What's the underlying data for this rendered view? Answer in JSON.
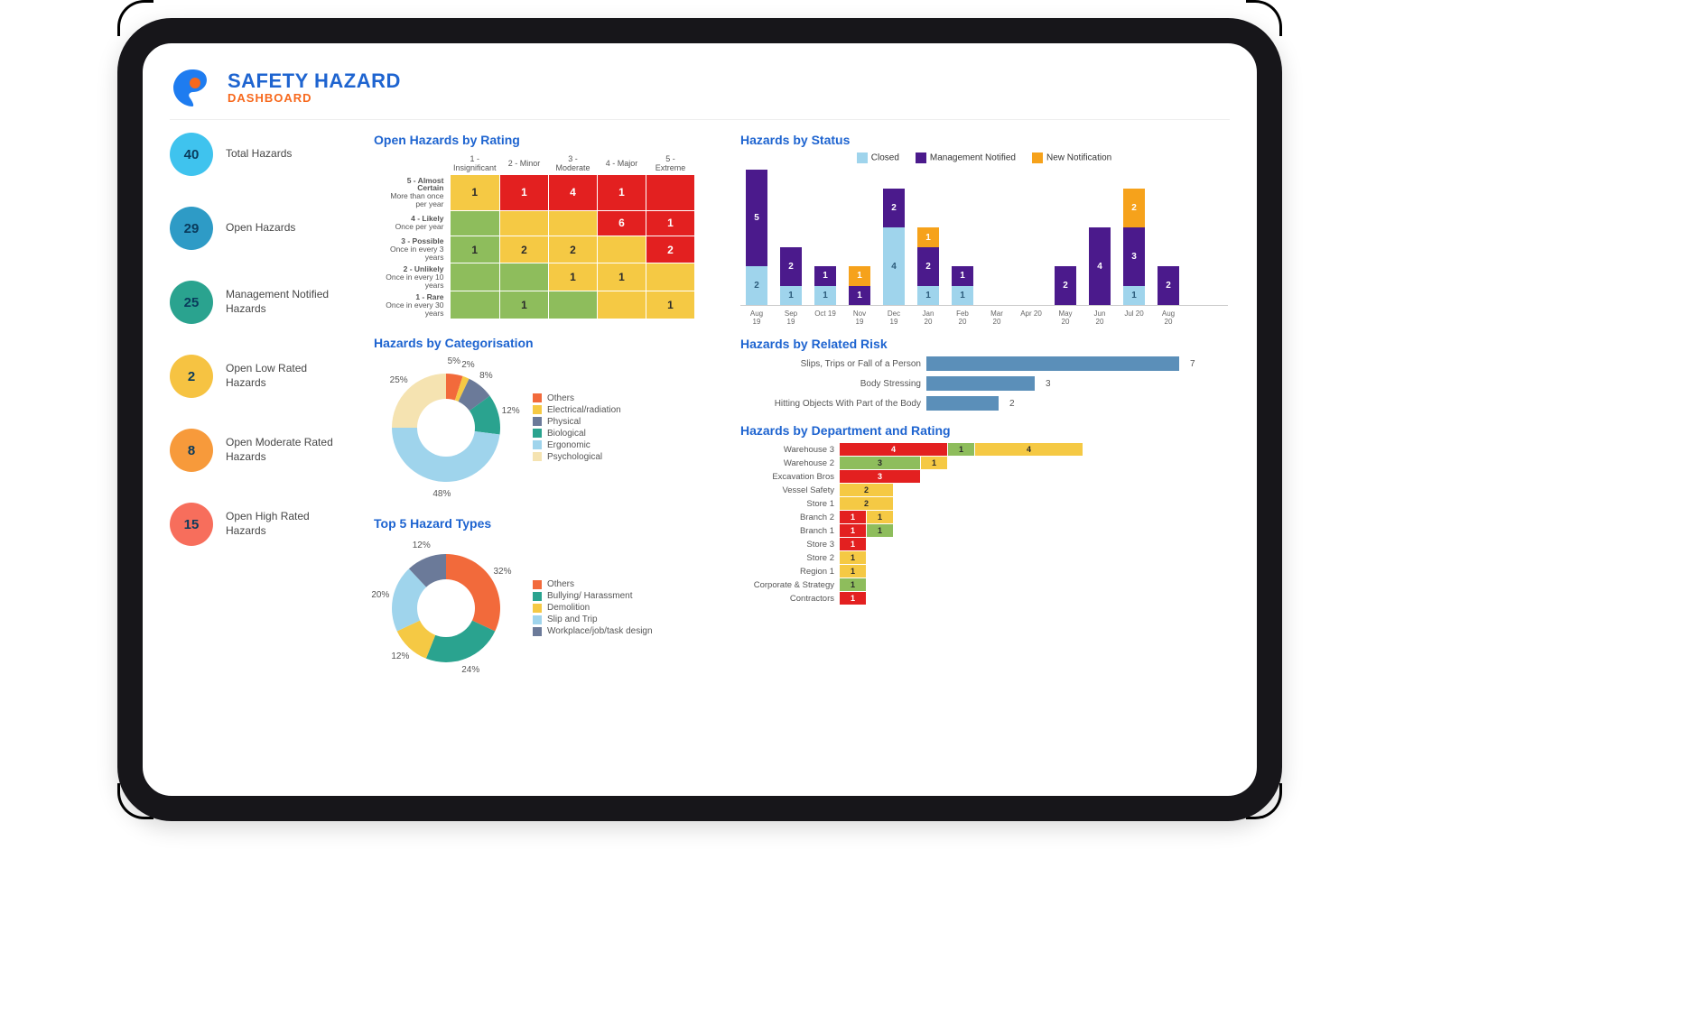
{
  "header": {
    "title": "SAFETY HAZARD",
    "subtitle": "DASHBOARD"
  },
  "colors": {
    "blue": "#1e64d0",
    "orange": "#f7681c",
    "kpi": {
      "total": "#3fc3ee",
      "open": "#2e9bc6",
      "mgmt": "#2aa38f",
      "low": "#f6c342",
      "moderate": "#f79a3b",
      "high": "#f76e5c"
    },
    "matrix": {
      "green": "#8ebd5c",
      "yellow": "#f5c944",
      "red": "#e32020"
    },
    "status": {
      "closed": "#9fd4ec",
      "mgmt": "#4b1a8c",
      "new": "#f6a21b"
    },
    "donutA": [
      "#f26a3b",
      "#f5c944",
      "#6b7a99",
      "#2aa38f",
      "#9fd4ec",
      "#f5e3b1"
    ],
    "donutB": [
      "#f26a3b",
      "#2aa38f",
      "#f5c944",
      "#9fd4ec",
      "#6b7a99"
    ],
    "dept": {
      "red": "#e32020",
      "green": "#8ebd5c",
      "yellow": "#f5c944"
    }
  },
  "kpis": [
    {
      "value": "40",
      "label": "Total Hazards",
      "colorKey": "total"
    },
    {
      "value": "29",
      "label": "Open Hazards",
      "colorKey": "open"
    },
    {
      "value": "25",
      "label": "Management Notified Hazards",
      "colorKey": "mgmt"
    },
    {
      "value": "2",
      "label": "Open Low Rated Hazards",
      "colorKey": "low"
    },
    {
      "value": "8",
      "label": "Open Moderate Rated Hazards",
      "colorKey": "moderate"
    },
    {
      "value": "15",
      "label": "Open High Rated Hazards",
      "colorKey": "high"
    }
  ],
  "matrix": {
    "title": "Open Hazards by Rating",
    "cols": [
      "1 - Insignificant",
      "2 - Minor",
      "3 - Moderate",
      "4 - Major",
      "5 - Extreme"
    ],
    "rows": [
      {
        "label": "5 - Almost Certain",
        "sub": "More than once per year",
        "cells": [
          {
            "v": "1",
            "c": "yellow"
          },
          {
            "v": "1",
            "c": "red"
          },
          {
            "v": "4",
            "c": "red"
          },
          {
            "v": "1",
            "c": "red"
          },
          {
            "v": "",
            "c": "red"
          }
        ]
      },
      {
        "label": "4 - Likely",
        "sub": "Once per year",
        "cells": [
          {
            "v": "",
            "c": "green"
          },
          {
            "v": "",
            "c": "yellow"
          },
          {
            "v": "",
            "c": "yellow"
          },
          {
            "v": "6",
            "c": "red"
          },
          {
            "v": "1",
            "c": "red"
          }
        ]
      },
      {
        "label": "3 - Possible",
        "sub": "Once in every 3 years",
        "cells": [
          {
            "v": "1",
            "c": "green"
          },
          {
            "v": "2",
            "c": "yellow"
          },
          {
            "v": "2",
            "c": "yellow"
          },
          {
            "v": "",
            "c": "yellow"
          },
          {
            "v": "2",
            "c": "red"
          }
        ]
      },
      {
        "label": "2 - Unlikely",
        "sub": "Once in every 10 years",
        "cells": [
          {
            "v": "",
            "c": "green"
          },
          {
            "v": "",
            "c": "green"
          },
          {
            "v": "1",
            "c": "yellow"
          },
          {
            "v": "1",
            "c": "yellow"
          },
          {
            "v": "",
            "c": "yellow"
          }
        ]
      },
      {
        "label": "1 - Rare",
        "sub": "Once in every 30 years",
        "cells": [
          {
            "v": "",
            "c": "green"
          },
          {
            "v": "1",
            "c": "green"
          },
          {
            "v": "",
            "c": "green"
          },
          {
            "v": "",
            "c": "yellow"
          },
          {
            "v": "1",
            "c": "yellow"
          }
        ]
      }
    ]
  },
  "donutA": {
    "title": "Hazards by Categorisation",
    "items": [
      {
        "label": "Others",
        "pct": 5
      },
      {
        "label": "Electrical/radiation",
        "pct": 2
      },
      {
        "label": "Physical",
        "pct": 8
      },
      {
        "label": "Biological",
        "pct": 12
      },
      {
        "label": "Ergonomic",
        "pct": 48
      },
      {
        "label": "Psychological",
        "pct": 25
      }
    ],
    "labels_cw": [
      {
        "txt": "5%",
        "pct": 5
      },
      {
        "txt": "2%",
        "pct": 2
      },
      {
        "txt": "8%",
        "pct": 8
      },
      {
        "txt": "12%",
        "pct": 12
      },
      {
        "txt": "48%",
        "pct": 48
      },
      {
        "txt": "25%",
        "pct": 25
      }
    ]
  },
  "donutB": {
    "title": "Top 5 Hazard Types",
    "items": [
      {
        "label": "Others",
        "pct": 32
      },
      {
        "label": "Bullying/ Harassment",
        "pct": 24
      },
      {
        "label": "Demolition",
        "pct": 12
      },
      {
        "label": "Slip and Trip",
        "pct": 20
      },
      {
        "label": "Workplace/job/task design",
        "pct": 12
      }
    ],
    "labels_cw": [
      {
        "txt": "32%",
        "pct": 32
      },
      {
        "txt": "24%",
        "pct": 24
      },
      {
        "txt": "12%",
        "pct": 12
      },
      {
        "txt": "20%",
        "pct": 20
      },
      {
        "txt": "12%",
        "pct": 12
      }
    ]
  },
  "status": {
    "title": "Hazards by Status",
    "legend": [
      {
        "label": "Closed",
        "key": "closed"
      },
      {
        "label": "Management Notified",
        "key": "mgmt"
      },
      {
        "label": "New Notification",
        "key": "new"
      }
    ],
    "months": [
      "Aug 19",
      "Sep 19",
      "Oct 19",
      "Nov 19",
      "Dec 19",
      "Jan 20",
      "Feb 20",
      "Mar 20",
      "Apr 20",
      "May 20",
      "Jun 20",
      "Jul 20",
      "Aug 20"
    ],
    "stacks": [
      [
        {
          "k": "closed",
          "v": 2
        },
        {
          "k": "mgmt",
          "v": 5
        }
      ],
      [
        {
          "k": "closed",
          "v": 1
        },
        {
          "k": "mgmt",
          "v": 2
        }
      ],
      [
        {
          "k": "closed",
          "v": 1
        },
        {
          "k": "mgmt",
          "v": 1
        }
      ],
      [
        {
          "k": "mgmt",
          "v": 1
        },
        {
          "k": "new",
          "v": 1
        }
      ],
      [
        {
          "k": "closed",
          "v": 4
        },
        {
          "k": "mgmt",
          "v": 2
        }
      ],
      [
        {
          "k": "closed",
          "v": 1
        },
        {
          "k": "mgmt",
          "v": 2
        },
        {
          "k": "new",
          "v": 1
        }
      ],
      [
        {
          "k": "closed",
          "v": 1
        },
        {
          "k": "mgmt",
          "v": 1
        }
      ],
      [],
      [],
      [
        {
          "k": "mgmt",
          "v": 2
        }
      ],
      [
        {
          "k": "mgmt",
          "v": 4
        }
      ],
      [
        {
          "k": "closed",
          "v": 1
        },
        {
          "k": "mgmt",
          "v": 3
        },
        {
          "k": "new",
          "v": 2
        }
      ],
      [
        {
          "k": "mgmt",
          "v": 2
        }
      ]
    ],
    "ymax": 7
  },
  "relatedRisk": {
    "title": "Hazards by Related Risk",
    "rows": [
      {
        "label": "Slips, Trips or Fall of a Person",
        "v": 7
      },
      {
        "label": "Body Stressing",
        "v": 3
      },
      {
        "label": "Hitting Objects With Part of the Body",
        "v": 2
      }
    ],
    "max": 7
  },
  "dept": {
    "title": "Hazards by Department and Rating",
    "rows": [
      {
        "label": "Warehouse 3",
        "segs": [
          {
            "c": "red",
            "v": 4
          },
          {
            "c": "green",
            "v": 1
          },
          {
            "c": "yellow",
            "v": 4
          }
        ]
      },
      {
        "label": "Warehouse 2",
        "segs": [
          {
            "c": "green",
            "v": 3
          },
          {
            "c": "yellow",
            "v": 1
          }
        ]
      },
      {
        "label": "Excavation Bros",
        "segs": [
          {
            "c": "red",
            "v": 3
          }
        ]
      },
      {
        "label": "Vessel Safety",
        "segs": [
          {
            "c": "yellow",
            "v": 2
          }
        ]
      },
      {
        "label": "Store 1",
        "segs": [
          {
            "c": "yellow",
            "v": 2
          }
        ]
      },
      {
        "label": "Branch 2",
        "segs": [
          {
            "c": "red",
            "v": 1
          },
          {
            "c": "yellow",
            "v": 1
          }
        ]
      },
      {
        "label": "Branch 1",
        "segs": [
          {
            "c": "red",
            "v": 1
          },
          {
            "c": "green",
            "v": 1
          }
        ]
      },
      {
        "label": "Store 3",
        "segs": [
          {
            "c": "red",
            "v": 1
          }
        ]
      },
      {
        "label": "Store 2",
        "segs": [
          {
            "c": "yellow",
            "v": 1
          }
        ]
      },
      {
        "label": "Region 1",
        "segs": [
          {
            "c": "yellow",
            "v": 1
          }
        ]
      },
      {
        "label": "Corporate & Strategy",
        "segs": [
          {
            "c": "green",
            "v": 1
          }
        ]
      },
      {
        "label": "Contractors",
        "segs": [
          {
            "c": "red",
            "v": 1
          }
        ]
      }
    ],
    "unit": 30
  },
  "chart_data": [
    {
      "type": "heatmap",
      "title": "Open Hazards by Rating",
      "x": [
        "1 - Insignificant",
        "2 - Minor",
        "3 - Moderate",
        "4 - Major",
        "5 - Extreme"
      ],
      "y": [
        "5 - Almost Certain",
        "4 - Likely",
        "3 - Possible",
        "2 - Unlikely",
        "1 - Rare"
      ],
      "values": [
        [
          1,
          1,
          4,
          1,
          null
        ],
        [
          null,
          null,
          null,
          6,
          1
        ],
        [
          1,
          2,
          2,
          null,
          2
        ],
        [
          null,
          null,
          1,
          1,
          null
        ],
        [
          null,
          1,
          null,
          null,
          1
        ]
      ]
    },
    {
      "type": "pie",
      "title": "Hazards by Categorisation",
      "series": [
        {
          "name": "Others",
          "value": 5
        },
        {
          "name": "Electrical/radiation",
          "value": 2
        },
        {
          "name": "Physical",
          "value": 8
        },
        {
          "name": "Biological",
          "value": 12
        },
        {
          "name": "Ergonomic",
          "value": 48
        },
        {
          "name": "Psychological",
          "value": 25
        }
      ]
    },
    {
      "type": "pie",
      "title": "Top 5 Hazard Types",
      "series": [
        {
          "name": "Others",
          "value": 32
        },
        {
          "name": "Bullying/ Harassment",
          "value": 24
        },
        {
          "name": "Demolition",
          "value": 12
        },
        {
          "name": "Slip and Trip",
          "value": 20
        },
        {
          "name": "Workplace/job/task design",
          "value": 12
        }
      ]
    },
    {
      "type": "bar",
      "title": "Hazards by Status",
      "categories": [
        "Aug 19",
        "Sep 19",
        "Oct 19",
        "Nov 19",
        "Dec 19",
        "Jan 20",
        "Feb 20",
        "Mar 20",
        "Apr 20",
        "May 20",
        "Jun 20",
        "Jul 20",
        "Aug 20"
      ],
      "series": [
        {
          "name": "Closed",
          "values": [
            2,
            1,
            1,
            0,
            4,
            1,
            1,
            0,
            0,
            0,
            0,
            1,
            0
          ]
        },
        {
          "name": "Management Notified",
          "values": [
            5,
            2,
            1,
            1,
            2,
            2,
            1,
            0,
            0,
            2,
            4,
            3,
            2
          ]
        },
        {
          "name": "New Notification",
          "values": [
            0,
            0,
            0,
            1,
            0,
            1,
            0,
            0,
            0,
            0,
            0,
            2,
            0
          ]
        }
      ],
      "ylim": [
        0,
        7
      ]
    },
    {
      "type": "bar",
      "title": "Hazards by Related Risk",
      "categories": [
        "Slips, Trips or Fall of a Person",
        "Body Stressing",
        "Hitting Objects With Part of the Body"
      ],
      "values": [
        7,
        3,
        2
      ]
    },
    {
      "type": "bar",
      "title": "Hazards by Department and Rating",
      "categories": [
        "Warehouse 3",
        "Warehouse 2",
        "Excavation Bros",
        "Vessel Safety",
        "Store 1",
        "Branch 2",
        "Branch 1",
        "Store 3",
        "Store 2",
        "Region 1",
        "Corporate & Strategy",
        "Contractors"
      ],
      "series": [
        {
          "name": "High (red)",
          "values": [
            4,
            0,
            3,
            0,
            0,
            1,
            1,
            1,
            0,
            0,
            0,
            1
          ]
        },
        {
          "name": "Low (green)",
          "values": [
            1,
            3,
            0,
            0,
            0,
            0,
            1,
            0,
            0,
            0,
            1,
            0
          ]
        },
        {
          "name": "Moderate (yellow)",
          "values": [
            4,
            1,
            0,
            2,
            2,
            1,
            0,
            0,
            1,
            1,
            0,
            0
          ]
        }
      ]
    }
  ]
}
